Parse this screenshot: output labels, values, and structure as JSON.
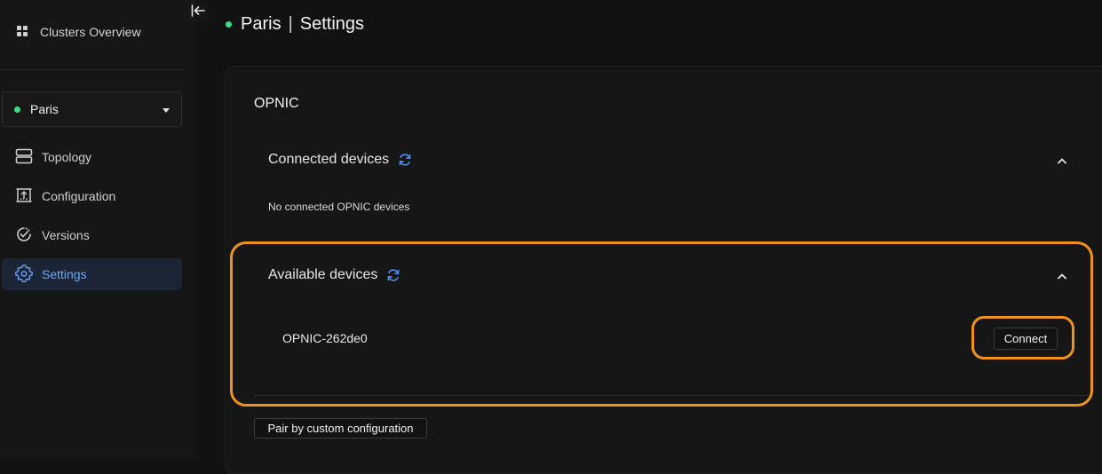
{
  "sidebar": {
    "clusters_overview": "Clusters Overview",
    "cluster_selector": {
      "selected": "Paris",
      "status_color": "#3ddc84"
    },
    "items": [
      {
        "label": "Topology",
        "icon": "topology-icon"
      },
      {
        "label": "Configuration",
        "icon": "configuration-icon"
      },
      {
        "label": "Versions",
        "icon": "versions-icon"
      },
      {
        "label": "Settings",
        "icon": "gear-icon",
        "active": true
      }
    ]
  },
  "header": {
    "cluster": "Paris",
    "separator": "|",
    "page": "Settings",
    "status_color": "#3ddc84"
  },
  "opnic": {
    "title": "OPNIC",
    "connected": {
      "title": "Connected devices",
      "empty_text": "No connected OPNIC devices"
    },
    "available": {
      "title": "Available devices",
      "devices": [
        {
          "name": "OPNIC-262de0",
          "action": "Connect"
        }
      ]
    },
    "pair_button": "Pair by custom configuration"
  },
  "colors": {
    "accent": "#4f8ff7",
    "highlight": "#f0931a",
    "active_bg": "#1b2535"
  }
}
